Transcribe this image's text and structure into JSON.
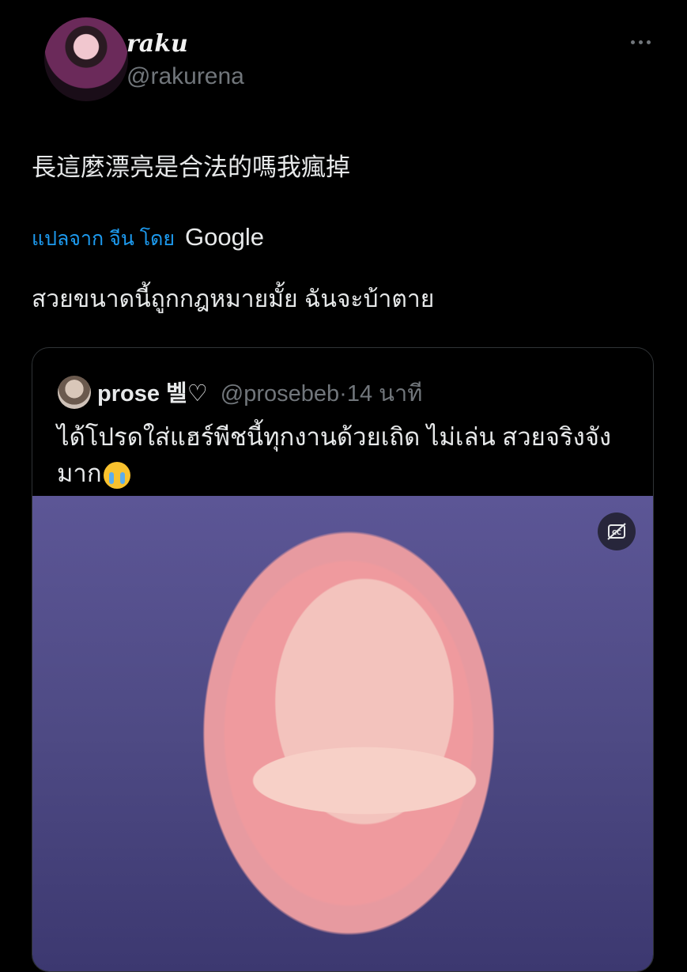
{
  "author": {
    "display_name": "raku",
    "handle": "@rakurena"
  },
  "tweet": {
    "text": "長這麼漂亮是合法的嗎我瘋掉",
    "translated_by_label": "แปลจาก จีน โดย",
    "translation_provider": "Google",
    "translation": "สวยขนาดนี้ถูกกฎหมายมั้ย ฉันจะบ้าตาย"
  },
  "quote": {
    "display_name": "prose 벨♡",
    "handle": "@prosebeb",
    "separator": "·",
    "time": "14 นาที",
    "text": "ได้โปรดใส่แฮร์พีชนี้ทุกงานด้วยเถิด ไม่เล่น สวยจริงจัง มาก"
  },
  "icons": {
    "more": "more-horizontal-icon",
    "captions": "captions-off-icon",
    "emoji": "loudly-crying-face-emoji"
  },
  "colors": {
    "background": "#000000",
    "text": "#e7e9ea",
    "secondary_text": "#71767b",
    "accent": "#1d9bf0",
    "border": "#2f3336"
  }
}
